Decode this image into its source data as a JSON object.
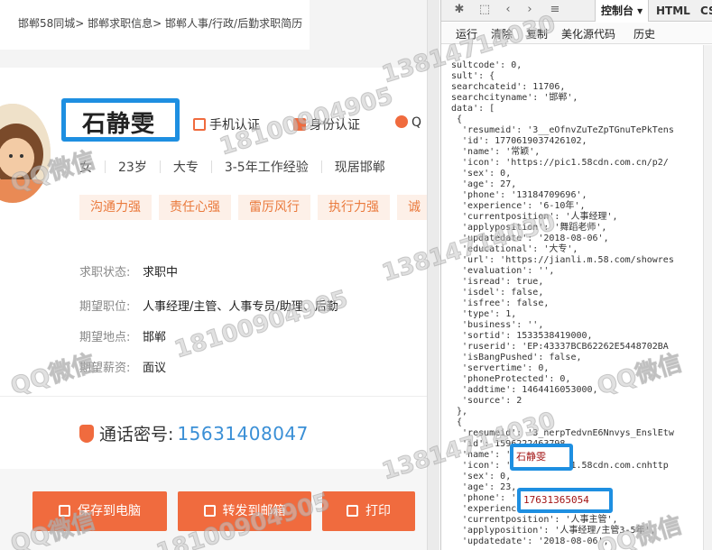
{
  "breadcrumb": "邯郸58同城> 邯郸求职信息> 邯郸人事/行政/后勤求职简历",
  "profile": {
    "name": "石静雯",
    "verifications": [
      "手机认证",
      "身份认证",
      "Q"
    ],
    "basics": [
      "女",
      "23岁",
      "大专",
      "3-5年工作经验",
      "现居邯郸"
    ],
    "tags": [
      "沟通力强",
      "责任心强",
      "雷厉风行",
      "执行力强",
      "诚"
    ]
  },
  "details": [
    {
      "label": "求职状态:",
      "value": "求职中"
    },
    {
      "label": "期望职位:",
      "value": "人事经理/主管、人事专员/助理、后勤"
    },
    {
      "label": "期望地点:",
      "value": "邯郸"
    },
    {
      "label": "期望薪资:",
      "value": "面议"
    }
  ],
  "call": {
    "label": "通话密号:",
    "number": "15631408047"
  },
  "buttons": {
    "save": "保存到电脑",
    "mail": "转发到邮箱",
    "print": "打印"
  },
  "devtools": {
    "tabs": {
      "console": "控制台 ▾",
      "html": "HTML",
      "css": "CS"
    },
    "subtoolbar": [
      "运行",
      "清除",
      "复制",
      "美化源代码",
      "历史"
    ],
    "highlight_name": "石静雯",
    "highlight_phone": "17631365054",
    "lines": [
      "sultcode': 0,",
      "sult': {",
      "searchcateid': 11706,",
      "searchcityname': '邯郸',",
      "data': [",
      " {",
      "  'resumeid': '3__eOfnvZuTeZpTGnuTePkTens",
      "  'id': 1770619037426102,",
      "  'name': '常颖',",
      "  'icon': 'https://pic1.58cdn.com.cn/p2/",
      "  'sex': 0,",
      "  'age': 27,",
      "  'phone': '13184709696',",
      "  'experience': '6-10年',",
      "  'currentposition': '人事经理',",
      "  'applyposition': '舞蹈老师',",
      "  'updatedate': '2018-08-06',",
      "  'educational': '大专',",
      "  'url': 'https://jianli.m.58.com/showres",
      "  'evaluation': '',",
      "  'isread': true,",
      "  'isdel': false,",
      "  'isfree': false,",
      "  'type': 1,",
      "  'business': '',",
      "  'sortid': 1533538419000,",
      "  'ruserid': 'EP:43337BCB62262E5448702BA",
      "  'isBangPushed': false,",
      "  'servertime': 0,",
      "  'phoneProtected': 0,",
      "  'addtime': 1464416053000,",
      "  'source': 2",
      " },",
      " {",
      "  'resumeid': '3_nerpTedvnE6Nnvys_EnslEtw",
      "  'id': 1596222463798,",
      "  'name': '",
      "  'icon': 'https://pic1.58cdn.com.cnhttp",
      "  'sex': 0,",
      "  'age': 23,",
      "  'phone': '",
      "  'experience': '3-5年',",
      "  'currentposition': '人事主管',",
      "  'applyposition': '人事经理/主管3-5年',",
      "  'updatedate': '2018-08-06',"
    ]
  },
  "watermarks": [
    "13814714030",
    "18100904905",
    "QQ微信"
  ]
}
